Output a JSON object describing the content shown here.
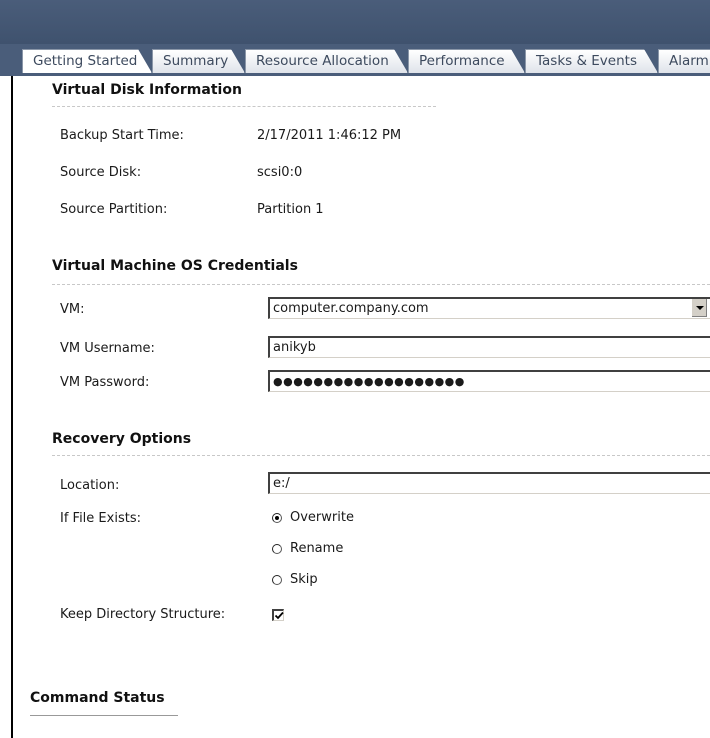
{
  "tabs": [
    {
      "label": "Getting Started",
      "active": true
    },
    {
      "label": "Summary",
      "active": false
    },
    {
      "label": "Resource Allocation",
      "active": false
    },
    {
      "label": "Performance",
      "active": false
    },
    {
      "label": "Tasks & Events",
      "active": false
    },
    {
      "label": "Alarm",
      "active": false
    }
  ],
  "disk_info": {
    "heading": "Virtual Disk Information",
    "backup_start_label": "Backup Start Time:",
    "backup_start_value": "2/17/2011 1:46:12 PM",
    "source_disk_label": "Source Disk:",
    "source_disk_value": "scsi0:0",
    "source_partition_label": "Source Partition:",
    "source_partition_value": "Partition 1"
  },
  "credentials": {
    "heading": "Virtual Machine OS Credentials",
    "vm_label": "VM:",
    "vm_value": "computer.company.com",
    "username_label": "VM Username:",
    "username_value": "anikyb",
    "password_label": "VM Password:",
    "password_value": "●●●●●●●●●●●●●●●●●●●"
  },
  "recovery": {
    "heading": "Recovery Options",
    "location_label": "Location:",
    "location_value": "e:/",
    "if_exists_label": "If File Exists:",
    "options": [
      {
        "label": "Overwrite",
        "checked": true
      },
      {
        "label": "Rename",
        "checked": false
      },
      {
        "label": "Skip",
        "checked": false
      }
    ],
    "keep_dir_label": "Keep Directory Structure:",
    "keep_dir_checked": true
  },
  "command_status": {
    "heading": "Command Status"
  }
}
